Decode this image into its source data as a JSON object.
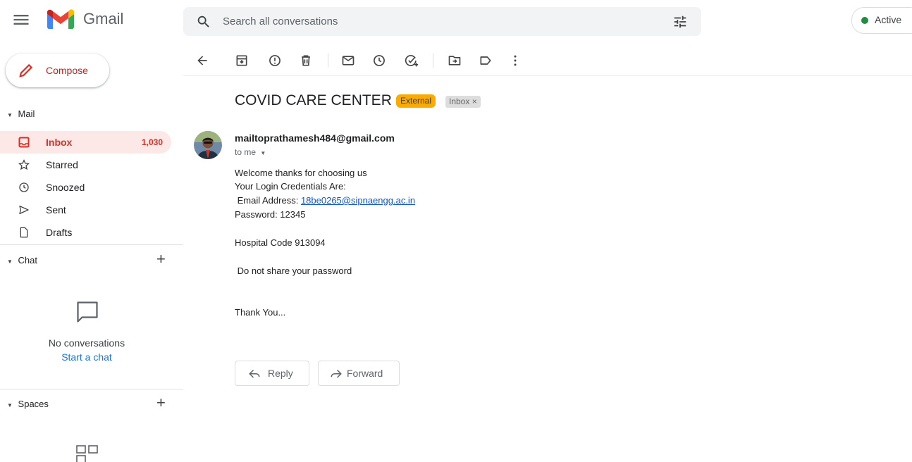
{
  "header": {
    "app_name": "Gmail",
    "search_placeholder": "Search all conversations",
    "status_label": "Active",
    "status_color": "#1e8e3e",
    "icons": [
      "menu-icon",
      "gmail-logo",
      "search-icon",
      "search-options-icon"
    ]
  },
  "sidebar": {
    "compose_label": "Compose",
    "mail_section": "Mail",
    "items": [
      {
        "label": "Inbox",
        "count": "1,030",
        "icon": "inbox-icon",
        "active": true
      },
      {
        "label": "Starred",
        "count": "",
        "icon": "star-icon",
        "active": false
      },
      {
        "label": "Snoozed",
        "count": "",
        "icon": "clock-icon",
        "active": false
      },
      {
        "label": "Sent",
        "count": "",
        "icon": "send-icon",
        "active": false
      },
      {
        "label": "Drafts",
        "count": "",
        "icon": "draft-icon",
        "active": false
      }
    ],
    "chat_section": "Chat",
    "chat_empty": "No conversations",
    "chat_start": "Start a chat",
    "spaces_section": "Spaces"
  },
  "toolbar": {
    "icons": [
      "back-icon",
      "archive-icon",
      "report-spam-icon",
      "delete-icon",
      "mark-unread-icon",
      "snooze-icon",
      "add-task-icon",
      "move-to-icon",
      "label-icon",
      "more-icon"
    ]
  },
  "email": {
    "subject": "COVID CARE CENTER",
    "badge_external": "External",
    "badge_inbox": "Inbox",
    "badge_inbox_close": "×",
    "sender": "mailtoprathamesh484@gmail.com",
    "to": "to me",
    "lines": {
      "l1": "Welcome thanks for choosing us",
      "l2": "Your Login Credentials Are:",
      "l3_prefix": " Email Address: ",
      "l3_link": "18be0265@sipnaengg.ac.in",
      "l4": "Password: 12345",
      "l5": "Hospital Code 913094",
      "l6": " Do not share your password",
      "l7": "Thank You..."
    },
    "reply_label": "Reply",
    "forward_label": "Forward"
  },
  "colors": {
    "accent_red": "#d93025",
    "active_bg": "#fce8e6",
    "external_badge": "#f9ab00",
    "link": "#1155cc"
  }
}
